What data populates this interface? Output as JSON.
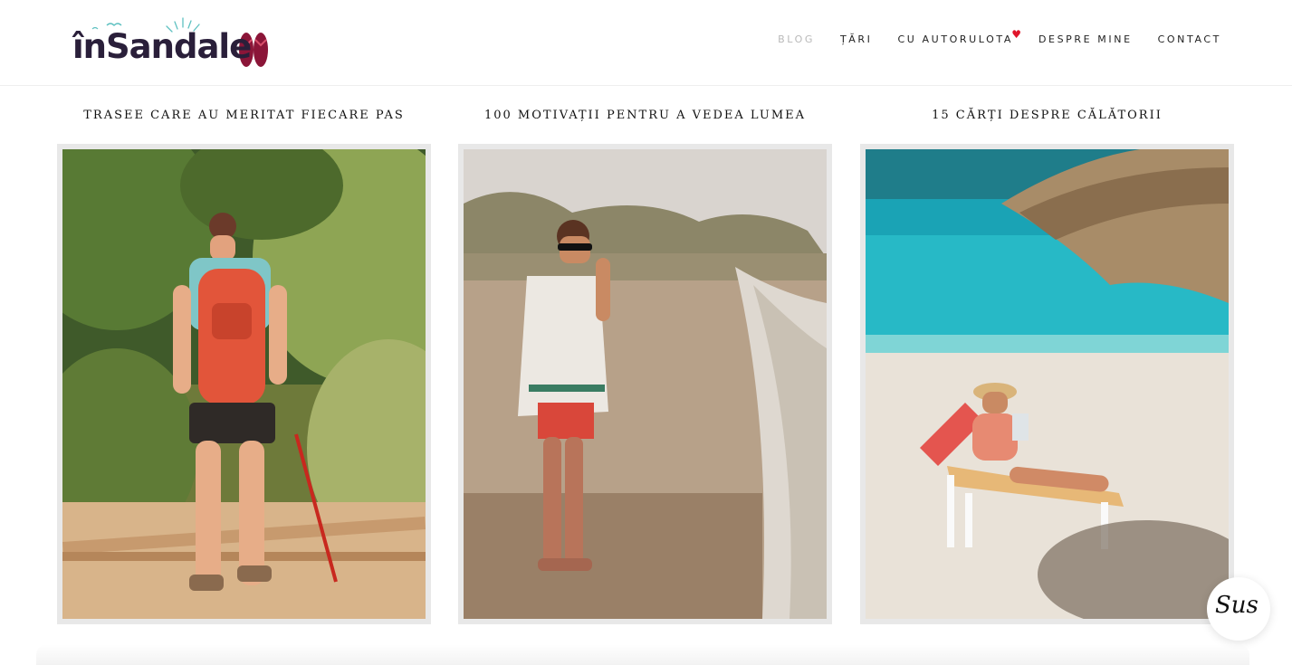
{
  "site": {
    "logo_text": "înSandale"
  },
  "nav": {
    "items": [
      {
        "label": "BLOG",
        "active": true
      },
      {
        "label": "ȚĂRI",
        "active": false
      },
      {
        "label": "CU AUTORULOTA",
        "active": false,
        "badge": "heart-icon"
      },
      {
        "label": "DESPRE MINE",
        "active": false
      },
      {
        "label": "CONTACT",
        "active": false
      }
    ],
    "badge_color": "#e0162b"
  },
  "posts": [
    {
      "title": "TRASEE CARE AU MERITAT FIECARE PAS",
      "image": "hiker-with-red-backpack-in-jungle"
    },
    {
      "title": "100 MOTIVAȚII PENTRU A VEDEA LUMEA",
      "image": "woman-standing-on-beach"
    },
    {
      "title": "15 CĂRȚI DESPRE CĂLĂTORII",
      "image": "woman-reading-on-beach-lounger"
    }
  ],
  "back_to_top": {
    "label": "Sus"
  }
}
